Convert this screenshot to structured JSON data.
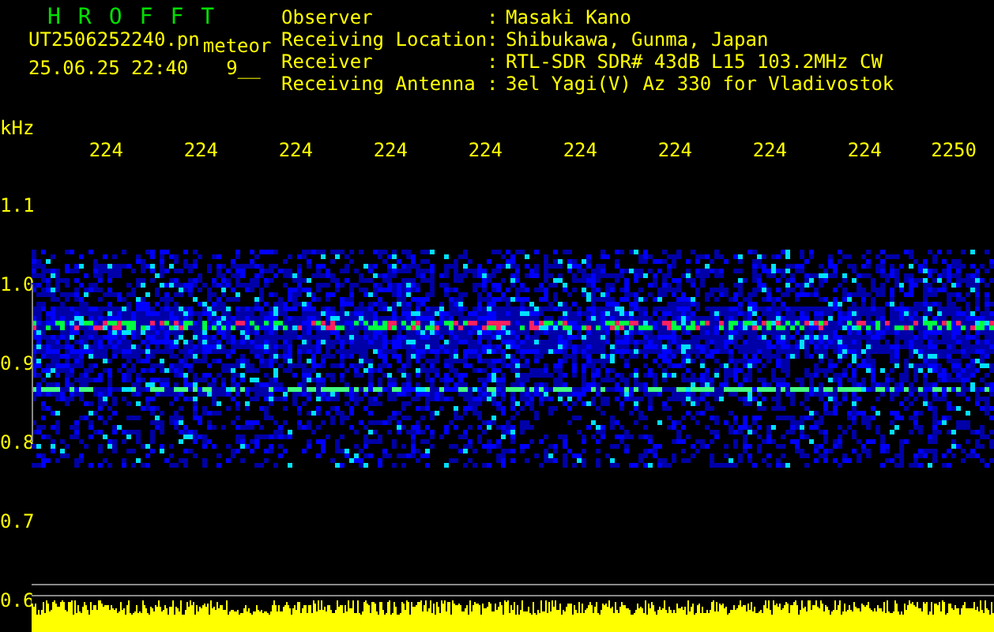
{
  "header": {
    "title": "HROFFT",
    "file_name": "UT2506252240.pn",
    "mode": "meteor",
    "timestamp": "25.06.25 22:40",
    "count": "9__"
  },
  "info": [
    {
      "label": "Observer",
      "separator": ":",
      "value": "Masaki Kano"
    },
    {
      "label": "Receiving Location",
      "separator": ":",
      "value": "Shibukawa, Gunma, Japan"
    },
    {
      "label": "Receiver",
      "separator": ":",
      "value": "RTL-SDR SDR# 43dB L15 103.2MHz CW"
    },
    {
      "label": "Receiving Antenna",
      "separator": ":",
      "value": "3el Yagi(V) Az 330 for Vladivostok"
    }
  ],
  "spectrogram": {
    "unit": "kHz",
    "x_labels": [
      "224",
      "224",
      "224",
      "224",
      "224",
      "224",
      "224",
      "224",
      "224",
      "2250"
    ],
    "y_labels": [
      "1.1",
      "1.0",
      "0.9",
      "0.8",
      "0.7",
      "0.6"
    ]
  }
}
